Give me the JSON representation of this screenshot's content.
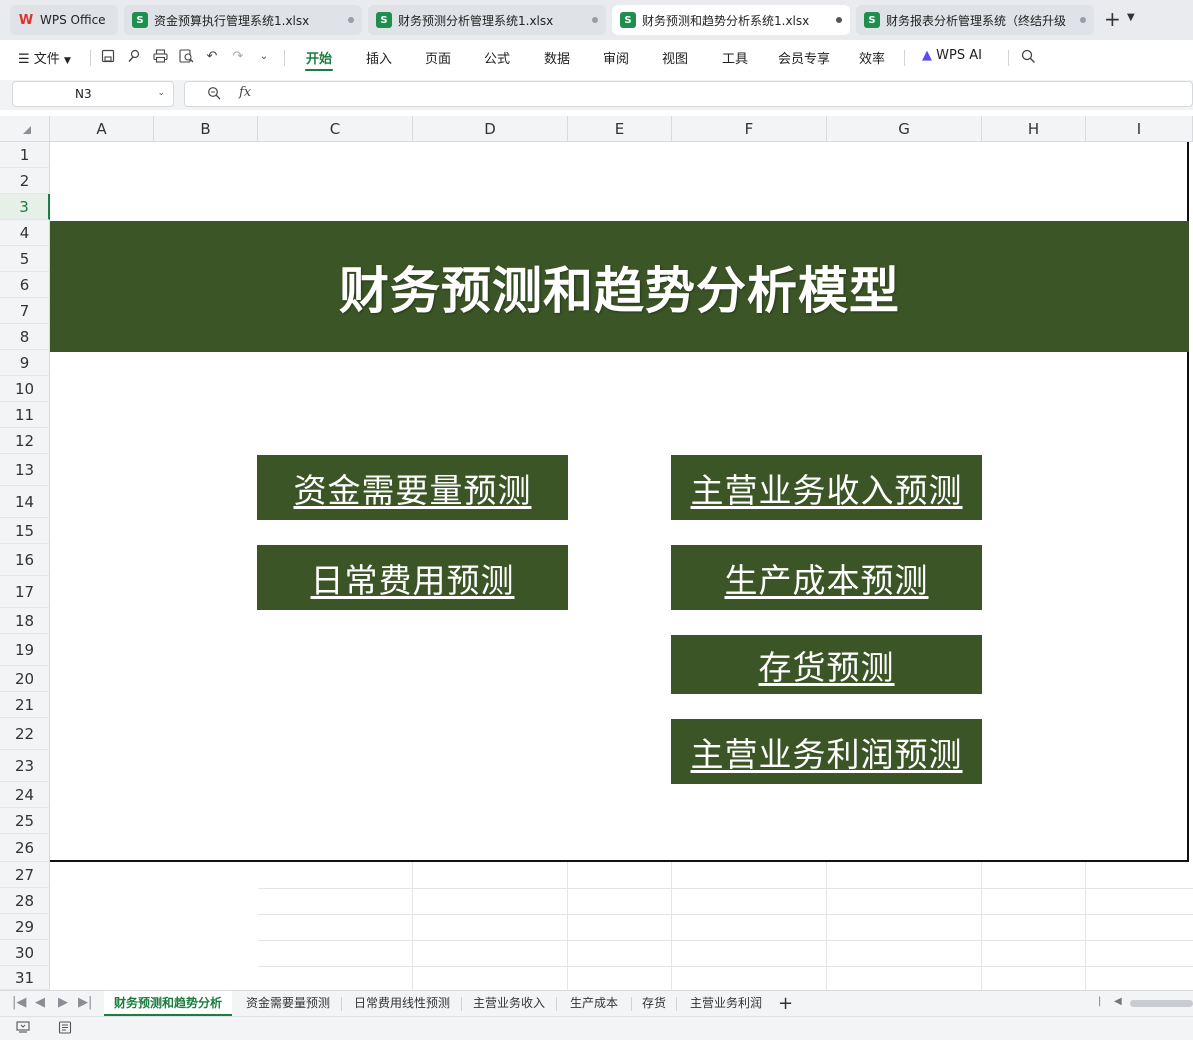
{
  "window_tabs": [
    {
      "label": "WPS Office",
      "icon": "wps-logo"
    },
    {
      "label": "资金预算执行管理系统1.xlsx",
      "icon": "spreadsheet-icon"
    },
    {
      "label": "财务预测分析管理系统1.xlsx",
      "icon": "spreadsheet-icon"
    },
    {
      "label": "财务预测和趋势分析系统1.xlsx",
      "icon": "spreadsheet-icon",
      "active": true
    },
    {
      "label": "财务报表分析管理系统（终结升级",
      "icon": "spreadsheet-icon"
    }
  ],
  "menu": {
    "file": "文件",
    "items": [
      "开始",
      "插入",
      "页面",
      "公式",
      "数据",
      "审阅",
      "视图",
      "工具",
      "会员专享",
      "效率",
      "WPS AI"
    ],
    "active": "开始"
  },
  "formula_bar": {
    "cell_ref": "N3",
    "fx": "fx",
    "content": ""
  },
  "columns": [
    "A",
    "B",
    "C",
    "D",
    "E",
    "F",
    "G",
    "H",
    "I"
  ],
  "rows": [
    "1",
    "2",
    "3",
    "4",
    "5",
    "6",
    "7",
    "8",
    "9",
    "10",
    "11",
    "12",
    "13",
    "14",
    "15",
    "16",
    "17",
    "18",
    "19",
    "20",
    "21",
    "22",
    "23",
    "24",
    "25",
    "26",
    "27",
    "28",
    "29",
    "30",
    "31"
  ],
  "selected_row": "3",
  "sheet": {
    "title": "财务预测和趋势分析模型",
    "buttons": {
      "capital_demand": "资金需要量预测",
      "revenue": "主营业务收入预测",
      "daily_expense": "日常费用预测",
      "production_cost": "生产成本预测",
      "inventory": "存货预测",
      "profit": "主营业务利润预测"
    },
    "colors": {
      "banner": "#3b5526",
      "button": "#3b5526",
      "text": "#ffffff"
    }
  },
  "sheet_tabs": [
    "财务预测和趋势分析",
    "资金需要量预测",
    "日常费用线性预测",
    "主营业务收入",
    "生产成本",
    "存货",
    "主营业务利润"
  ],
  "active_sheet": "财务预测和趋势分析"
}
